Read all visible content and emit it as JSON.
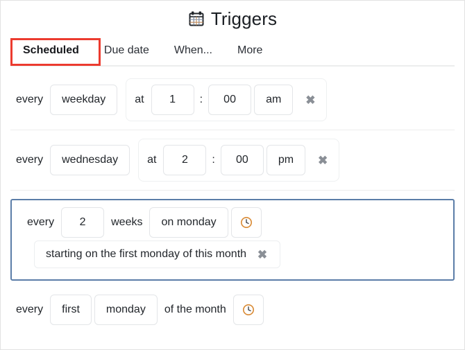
{
  "header": {
    "title": "Triggers",
    "icon": "calendar-icon"
  },
  "tabs": [
    {
      "label": "Scheduled",
      "active": true,
      "highlighted": true
    },
    {
      "label": "Due date",
      "active": false,
      "highlighted": false
    },
    {
      "label": "When...",
      "active": false,
      "highlighted": false
    },
    {
      "label": "More",
      "active": false,
      "highlighted": false
    }
  ],
  "colors": {
    "highlight_box": "#ec3b2f",
    "selected_border": "#5b7da8",
    "active_tab_underline": "#14171a",
    "divider": "#eceded",
    "pill_border": "#e3e5e8",
    "clock_icon": "#d98a34"
  },
  "triggers": [
    {
      "id": "row-1",
      "lead_word": "every",
      "day": "weekday",
      "at_word": "at",
      "hour": "1",
      "separator": ":",
      "minute": "00",
      "meridiem": "am",
      "remove_label": "✖"
    },
    {
      "id": "row-2",
      "lead_word": "every",
      "day": "wednesday",
      "at_word": "at",
      "hour": "2",
      "separator": ":",
      "minute": "00",
      "meridiem": "pm",
      "remove_label": "✖"
    }
  ],
  "selected_trigger": {
    "id": "row-3",
    "lead_word": "every",
    "interval": "2",
    "unit_word": "weeks",
    "day_phrase": "on monday",
    "clock_icon": "clock-icon",
    "start_phrase": "starting on the first monday of this month",
    "remove_label": "✖"
  },
  "monthly_trigger": {
    "id": "row-4",
    "lead_word": "every",
    "ordinal": "first",
    "day": "monday",
    "suffix_word": "of the month",
    "clock_icon": "clock-icon"
  }
}
